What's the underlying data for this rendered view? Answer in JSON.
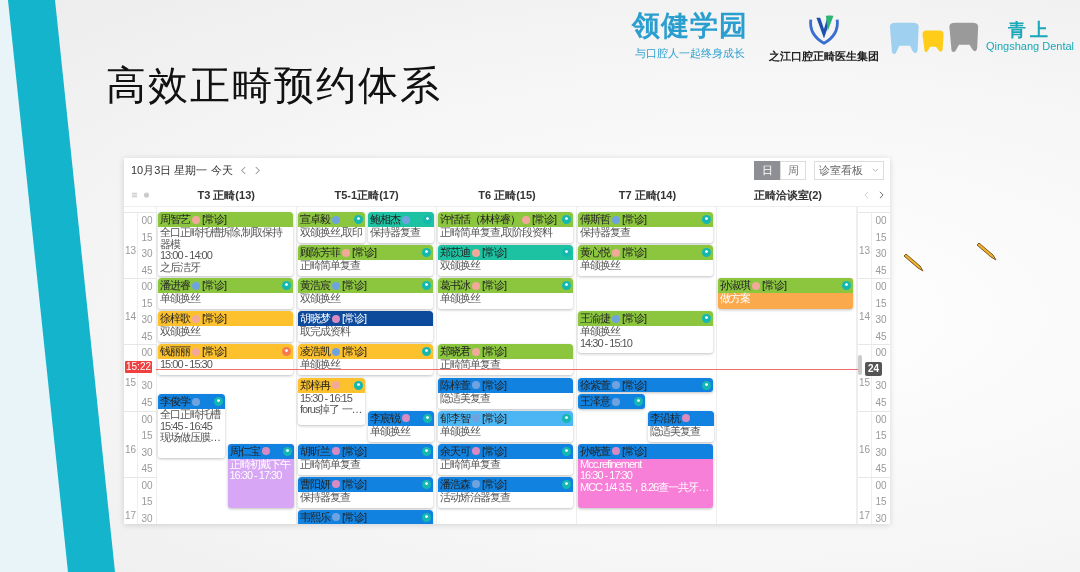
{
  "slide": {
    "title": "高效正畸预约体系"
  },
  "logos": {
    "brand": "领健学园",
    "slogan": "与口腔人一起终身成长",
    "emblem_caption": "之江口腔正畸医生集团",
    "partner": "青上",
    "partner_sub": "Qingshang Dental"
  },
  "calendar": {
    "date_label": "10月3日 星期一",
    "today_button": "今天",
    "views": [
      {
        "label": "日",
        "selected": true
      },
      {
        "label": "周",
        "selected": false
      }
    ],
    "board_select": "诊室看板",
    "now_label": "15:22",
    "now_badge": "24",
    "left_gutter": [
      {
        "hour": "13",
        "minutes": [
          "00",
          "15",
          "30",
          "45"
        ]
      },
      {
        "hour": "14",
        "minutes": [
          "00",
          "15",
          "30",
          "45"
        ]
      },
      {
        "hour": "15",
        "minutes": [
          "00",
          "30",
          "45"
        ]
      },
      {
        "hour": "16",
        "minutes": [
          "00",
          "15",
          "30",
          "45"
        ]
      },
      {
        "hour": "17",
        "minutes": [
          "00",
          "15",
          "30"
        ]
      }
    ],
    "right_gutter": [
      {
        "hour": "13",
        "minutes": [
          "00",
          "15",
          "30",
          "45"
        ]
      },
      {
        "hour": "14",
        "minutes": [
          "00",
          "15",
          "30",
          "45"
        ]
      },
      {
        "hour": "15",
        "minutes": [
          "00",
          "30",
          "45"
        ]
      },
      {
        "hour": "16",
        "minutes": [
          "00",
          "15",
          "30",
          "45"
        ]
      },
      {
        "hour": "17",
        "minutes": [
          "00",
          "15",
          "30"
        ]
      }
    ],
    "rooms": [
      {
        "title": "T3 正畸(13)",
        "appointments": [
          {
            "name": "周智艺",
            "avatar": {
              "color": "#f2a99a"
            },
            "tag": "[常诊]",
            "color": "#8cc63f",
            "lines": [
              "全口正畸托槽拆除,制取保持器模",
              "13:00 - 14:00",
              "之后洁牙"
            ]
          },
          {
            "name": "潘进睿",
            "avatar": {
              "color": "#6fa3e0"
            },
            "tag": "[常诊]",
            "color": "#8cc63f",
            "status": {
              "color": "#14b8b0"
            },
            "lines": [
              "单颌换丝"
            ]
          },
          {
            "name": "徐梓歌",
            "avatar": {
              "color": "#f2a99a"
            },
            "tag": "[常诊]",
            "color": "#fcc12d",
            "lines": [
              "双颌换丝"
            ]
          },
          {
            "name": "钱丽丽",
            "avatar": {
              "color": "#f2a99a"
            },
            "tag": "[常诊]",
            "color": "#fcc12d",
            "status": {
              "color": "#f47c4f"
            },
            "lines": [
              "15:00 - 15:30"
            ]
          },
          {
            "name": "李俊学",
            "avatar": {
              "color": "#6fa3e0"
            },
            "color": "#1282e0",
            "status": {
              "color": "#14b8b0"
            },
            "lines": [
              "全口正畸托槽",
              "15:45 - 16:45",
              "现场做压膜…"
            ]
          },
          {
            "name": "周仁宝",
            "avatar": {
              "color": "#d98ac0"
            },
            "color": "#1282e0",
            "status": {
              "color": "#14b8b0"
            },
            "body": {
              "color": "#d7a6f5"
            },
            "lines": [
              "正畸初戴下午",
              "16:30 - 17:30"
            ]
          }
        ]
      },
      {
        "title": "T5-1正畸(17)",
        "appointments": [
          {
            "name": "宣卓毅",
            "avatar": {
              "color": "#6fa3e0"
            },
            "color": "#8cc63f",
            "status": {
              "color": "#14b8b0"
            },
            "lines": [
              "双颌换丝,取印"
            ]
          },
          {
            "name": "鲍相杰",
            "avatar": {
              "color": "#6fa3e0"
            },
            "color": "#1cc2a2",
            "status": {
              "color": "#14b8b0"
            },
            "lines": [
              "保持器复查"
            ]
          },
          {
            "name": "顾陈芳菲",
            "avatar": {
              "color": "#f2a99a"
            },
            "tag": "[常诊]",
            "color": "#8cc63f",
            "status": {
              "color": "#14b8b0"
            },
            "lines": [
              "正畸简单复查"
            ]
          },
          {
            "name": "黄浩宸",
            "avatar": {
              "color": "#6fa3e0"
            },
            "tag": "[常诊]",
            "color": "#8cc63f",
            "status": {
              "color": "#14b8b0"
            },
            "lines": [
              "双颌换丝"
            ]
          },
          {
            "name": "胡晓梦",
            "avatar": {
              "color": "#d98ac0"
            },
            "tag": "[常诊]",
            "color": "#0d4a9c",
            "lines": [
              "取完成资料"
            ]
          },
          {
            "name": "凌浩凯",
            "avatar": {
              "color": "#6fa3e0"
            },
            "tag": "[常诊]",
            "color": "#fcc12d",
            "status": {
              "color": "#14b8b0"
            },
            "lines": [
              "单颌换丝"
            ]
          },
          {
            "name": "郑梓冉",
            "avatar": {
              "color": "#f2a99a"
            },
            "color": "#fcc12d",
            "status": {
              "color": "#14b8b0"
            },
            "lines": [
              "15:30 - 16:15",
              "forus掉了 一…"
            ]
          },
          {
            "name": "李宸锐",
            "avatar": {
              "color": "#d98ac0"
            },
            "color": "#1282e0",
            "status": {
              "color": "#14b8b0"
            },
            "lines": [
              "单颌换丝"
            ]
          },
          {
            "name": "胡昕兰",
            "avatar": {
              "color": "#d98ac0"
            },
            "tag": "[常诊]",
            "color": "#1282e0",
            "status": {
              "color": "#14b8b0"
            },
            "lines": [
              "正畸简单复查"
            ]
          },
          {
            "name": "曹阳妍",
            "avatar": {
              "color": "#d98ac0"
            },
            "tag": "[常诊]",
            "color": "#1282e0",
            "status": {
              "color": "#14b8b0"
            },
            "lines": [
              "保持器复查"
            ]
          },
          {
            "name": "韦熙乐",
            "avatar": {
              "color": "#6fa3e0"
            },
            "tag": "[常诊]",
            "color": "#1282e0",
            "status": {
              "color": "#14b8b0"
            }
          }
        ]
      },
      {
        "title": "T6 正畸(15)",
        "appointments": [
          {
            "name": "许恬恬（林梓睿）",
            "avatar": {
              "color": "#f2a99a"
            },
            "tag": "[常诊]",
            "color": "#8cc63f",
            "status": {
              "color": "#14b8b0"
            },
            "lines": [
              "正畸简单复查,取阶段资料"
            ]
          },
          {
            "name": "郑苡迪",
            "avatar": {
              "color": "#f2a99a"
            },
            "tag": "[常诊]",
            "color": "#1cc2a2",
            "status": {
              "color": "#14b8b0"
            },
            "lines": [
              "双颌换丝"
            ]
          },
          {
            "name": "葛书冰",
            "avatar": {
              "color": "#f2a99a"
            },
            "tag": "[常诊]",
            "color": "#8cc63f",
            "status": {
              "color": "#14b8b0"
            },
            "lines": [
              "单颌换丝"
            ]
          },
          {
            "name": "郑晓君",
            "avatar": {
              "color": "#f2a99a"
            },
            "tag": "[常诊]",
            "color": "#8cc63f",
            "lines": [
              "正畸简单复查"
            ]
          },
          {
            "name": "陈梓萱",
            "avatar": {
              "color": "#6fa3e0"
            },
            "tag": "[常诊]",
            "color": "#1282e0",
            "lines": [
              "隐适美复查"
            ]
          },
          {
            "name": "郁李智",
            "avatar": {
              "color": "#6fa3e0"
            },
            "tag": "[常诊]",
            "color": "#4cb6f5",
            "status": {
              "color": "#14b8b0"
            },
            "lines": [
              "单颌换丝"
            ]
          },
          {
            "name": "余天可",
            "avatar": {
              "color": "#d98ac0"
            },
            "tag": "[常诊]",
            "color": "#1282e0",
            "status": {
              "color": "#14b8b0"
            },
            "lines": [
              "正畸简单复查"
            ]
          },
          {
            "name": "潘浩森",
            "avatar": {
              "color": "#6fa3e0"
            },
            "tag": "[常诊]",
            "color": "#1282e0",
            "status": {
              "color": "#14b8b0"
            },
            "lines": [
              "活动矫治器复查"
            ]
          }
        ]
      },
      {
        "title": "T7 正畸(14)",
        "appointments": [
          {
            "name": "傅斯哲",
            "avatar": {
              "color": "#6fa3e0"
            },
            "tag": "[常诊]",
            "color": "#8cc63f",
            "status": {
              "color": "#14b8b0"
            },
            "lines": [
              "保持器复查"
            ]
          },
          {
            "name": "黄心悦",
            "avatar": {
              "color": "#f2a99a"
            },
            "tag": "[常诊]",
            "color": "#8cc63f",
            "status": {
              "color": "#14b8b0"
            },
            "lines": [
              "单颌换丝"
            ]
          },
          {
            "name": "王渝捷",
            "avatar": {
              "color": "#6fa3e0"
            },
            "tag": "[常诊]",
            "color": "#8cc63f",
            "status": {
              "color": "#14b8b0"
            },
            "lines": [
              "单颌换丝",
              "14:30 - 15:10"
            ]
          },
          {
            "name": "徐紫萱",
            "avatar": {
              "color": "#6fa3e0"
            },
            "tag": "[常诊]",
            "color": "#1282e0",
            "status": {
              "color": "#14b8b0"
            }
          },
          {
            "name": "王泽意",
            "avatar": {
              "color": "#6fa3e0"
            },
            "color": "#1282e0",
            "status": {
              "color": "#14b8b0"
            }
          },
          {
            "name": "李沿杭",
            "avatar": {
              "color": "#d98ac0"
            },
            "color": "#1282e0",
            "lines": [
              "隐适美复查"
            ]
          },
          {
            "name": "孙晓萱",
            "avatar": {
              "color": "#d98ac0"
            },
            "tag": "[常诊]",
            "color": "#1282e0",
            "body": {
              "color": "#f77fd8"
            },
            "lines": [
              "Mcc.refinement",
              "16:30 - 17:30",
              "MCC 1/4 3.5，8.26查一共牙…"
            ]
          }
        ]
      },
      {
        "title": "正畸洽谈室(2)",
        "appointments": [
          {
            "name": "孙淑琪",
            "avatar": {
              "color": "#f2a99a"
            },
            "tag": "[常诊]",
            "color": "#8cc63f",
            "status": {
              "color": "#14b8b0"
            },
            "body": {
              "color": "#fba94d"
            },
            "lines": [
              "做方案"
            ]
          }
        ]
      }
    ]
  }
}
